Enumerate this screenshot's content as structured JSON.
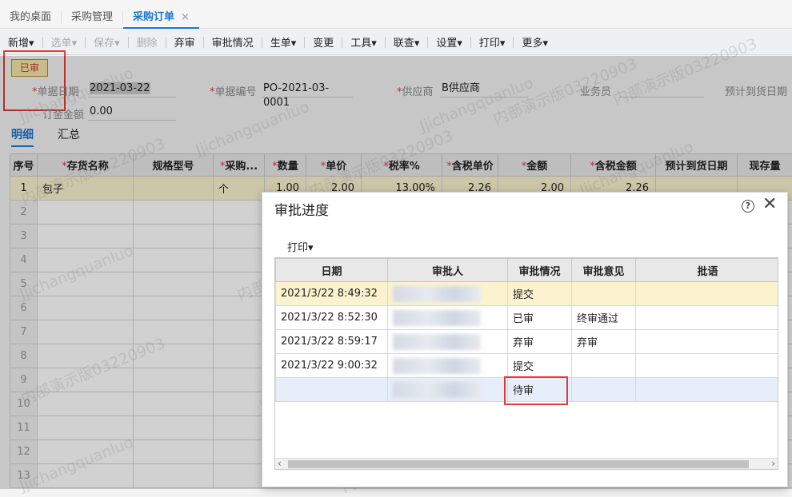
{
  "tabs": [
    {
      "label": "我的桌面"
    },
    {
      "label": "采购管理"
    },
    {
      "label": "采购订单",
      "close": "×"
    }
  ],
  "toolbar": {
    "items": [
      "新增",
      "选单",
      "保存",
      "删除",
      "弃审",
      "审批情况",
      "生单",
      "变更",
      "工具",
      "联查",
      "设置",
      "打印",
      "更多"
    ],
    "dropdown_glyph": "▾"
  },
  "status_badge": "已审",
  "form": {
    "date_label": "单据日期",
    "date_value": "2021-03-22",
    "no_label": "单据编号",
    "no_value": "PO-2021-03-0001",
    "supplier_label": "供应商",
    "supplier_value": "B供应商",
    "staff_label": "业务员",
    "eta_label": "预计到货日期",
    "deposit_label": "订金金额",
    "deposit_value": "0.00"
  },
  "subtabs": [
    "明细",
    "汇总"
  ],
  "grid": {
    "headers": [
      "序号",
      "存货名称",
      "规格型号",
      "采购...",
      "数量",
      "单价",
      "税率%",
      "含税单价",
      "金额",
      "含税金额",
      "预计到货日期",
      "现存量"
    ],
    "row1": {
      "idx": "1",
      "name": "包子",
      "spec": "",
      "unit": "个",
      "qty": "1.00",
      "price": "2.00",
      "tax": "13.00%",
      "tax_price": "2.26",
      "amount": "2.00",
      "tax_amount": "2.26"
    },
    "row_numbers": [
      "2",
      "3",
      "4",
      "5",
      "6",
      "7",
      "8",
      "9",
      "10",
      "11",
      "12",
      "13"
    ]
  },
  "watermark": [
    "Jjichangquanluo",
    "内部演示版03220903"
  ],
  "dialog": {
    "title": "审批进度",
    "help_icon": "?",
    "close_icon": "✕",
    "print_label": "打印",
    "headers": [
      "日期",
      "审批人",
      "审批情况",
      "审批意见",
      "批语"
    ],
    "rows": [
      {
        "date": "2021/3/22 8:49:32",
        "status": "提交",
        "opinion": "",
        "remark": ""
      },
      {
        "date": "2021/3/22 8:52:30",
        "status": "已审",
        "opinion": "终审通过",
        "remark": ""
      },
      {
        "date": "2021/3/22 8:59:17",
        "status": "弃审",
        "opinion": "弃审",
        "remark": ""
      },
      {
        "date": "2021/3/22 9:00:32",
        "status": "提交",
        "opinion": "",
        "remark": ""
      },
      {
        "date": "",
        "status": "待审",
        "opinion": "",
        "remark": ""
      }
    ]
  }
}
